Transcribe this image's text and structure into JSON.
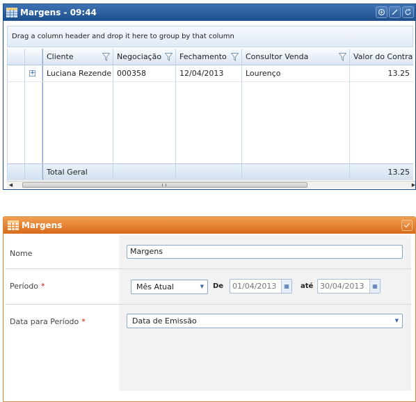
{
  "grid_widget": {
    "title": "Margens - 09:44",
    "group_panel_text": "Drag a column header and drop it here to group by that column",
    "columns": [
      "Cliente",
      "Negociação",
      "Fechamento",
      "Consultor Venda",
      "Valor do Contrat"
    ],
    "rows": [
      {
        "cliente": "Luciana Rezende",
        "negociacao": "000358",
        "fechamento": "12/04/2013",
        "consultor": "Lourenço",
        "valor": "13.25"
      }
    ],
    "footer": {
      "label": "Total Geral",
      "total": "13.25"
    },
    "colors": {
      "header": "#1d4f8c",
      "accent": "#c5d5ea"
    }
  },
  "form_widget": {
    "title": "Margens",
    "fields": {
      "nome": {
        "label": "Nome",
        "value": "Margens"
      },
      "periodo": {
        "label": "Período",
        "required_mark": "*",
        "selected": "Mês Atual",
        "de_label": "De",
        "de_value": "01/04/2013",
        "ate_label": "até",
        "ate_value": "30/04/2013"
      },
      "data_periodo": {
        "label": "Data para Período",
        "required_mark": "*",
        "selected": "Data de Emissão"
      }
    },
    "colors": {
      "header": "#d96a1b",
      "required": "#dd1111"
    }
  }
}
